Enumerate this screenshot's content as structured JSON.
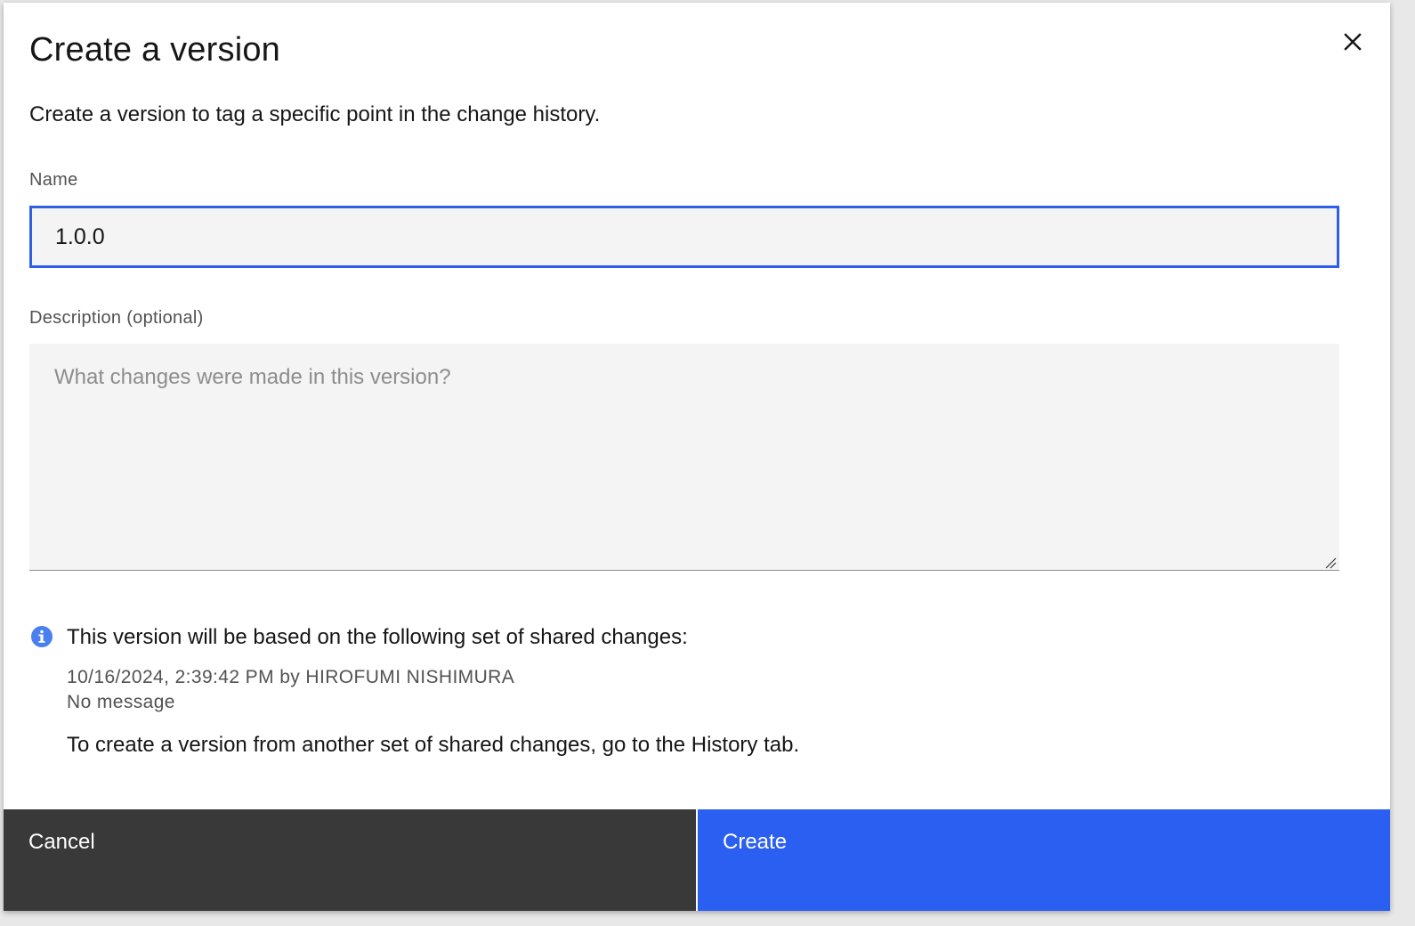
{
  "modal": {
    "title": "Create a version",
    "description": "Create a version to tag a specific point in the change history."
  },
  "form": {
    "name_label": "Name",
    "name_value": "1.0.0",
    "description_label": "Description (optional)",
    "description_placeholder": "What changes were made in this version?"
  },
  "info": {
    "heading": "This version will be based on the following set of shared changes:",
    "change_meta": "10/16/2024, 2:39:42 PM by HIROFUMI NISHIMURA",
    "change_message": "No message",
    "history_note": "To create a version from another set of shared changes, go to the History tab."
  },
  "footer": {
    "cancel_label": "Cancel",
    "create_label": "Create"
  },
  "colors": {
    "primary": "#2b5ff2",
    "secondary": "#393939",
    "focus": "#2f5ee8",
    "info_icon": "#4a7ff0"
  },
  "icons": {
    "close": "close-icon",
    "info": "info-icon",
    "resize": "resize-handle-icon"
  }
}
